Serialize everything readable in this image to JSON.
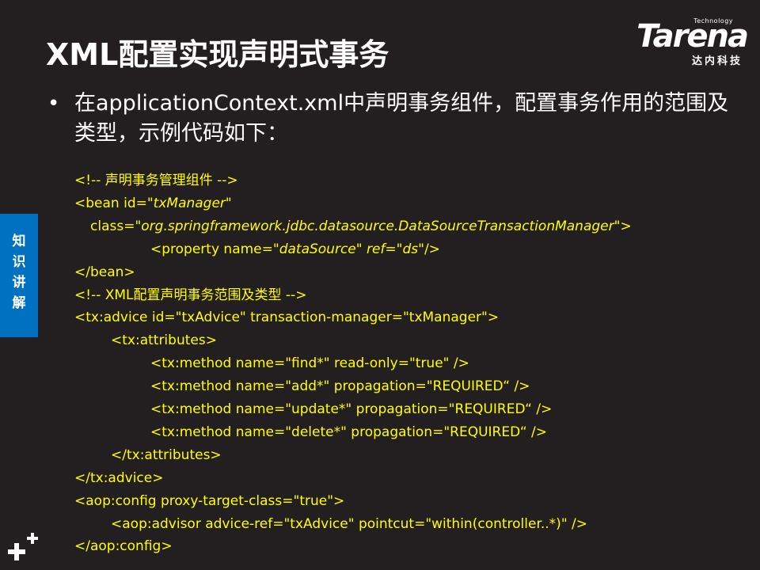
{
  "slide": {
    "title": "XML配置实现声明式事务",
    "bullet": "在applicationContext.xml中声明事务组件，配置事务作用的范围及类型，示例代码如下：",
    "side_tab": [
      "知",
      "识",
      "讲",
      "解"
    ],
    "logo": {
      "small": "Technology",
      "word": "Tarena",
      "cn": "达内科技"
    },
    "code_lines": [
      {
        "indent": 0,
        "parts": [
          {
            "t": "<!-- 声明事务管理组件 -->"
          }
        ]
      },
      {
        "indent": 0,
        "parts": [
          {
            "t": "<bean id=\""
          },
          {
            "t": "txManager\"",
            "i": true
          }
        ]
      },
      {
        "indent": 20,
        "parts": [
          {
            "t": "class=\""
          },
          {
            "t": "org.springframework.jdbc.datasource.DataSourceTransactionManager\"",
            "i": true
          },
          {
            "t": ">"
          }
        ]
      },
      {
        "indent": 96,
        "parts": [
          {
            "t": "<property name=\""
          },
          {
            "t": "dataSource\" ref=\"ds\"",
            "i": true
          },
          {
            "t": "/>"
          }
        ]
      },
      {
        "indent": 0,
        "parts": [
          {
            "t": "</bean>"
          }
        ]
      },
      {
        "indent": 0,
        "parts": [
          {
            "t": "<!-- XML配置声明事务范围及类型 -->"
          }
        ]
      },
      {
        "indent": 0,
        "parts": [
          {
            "t": "<tx:advice id=\"txAdvice\" transaction-manager=\"txManager\">"
          }
        ]
      },
      {
        "indent": 46,
        "parts": [
          {
            "t": "<tx:attributes>"
          }
        ]
      },
      {
        "indent": 96,
        "parts": [
          {
            "t": "<tx:method name=\"find*\" read-only=\"true\" />"
          }
        ]
      },
      {
        "indent": 96,
        "parts": [
          {
            "t": "<tx:method name=\"add*\" propagation=\"REQUIRED“ />"
          }
        ]
      },
      {
        "indent": 96,
        "parts": [
          {
            "t": "<tx:method name=\"update*\" propagation=\"REQUIRED“ />"
          }
        ]
      },
      {
        "indent": 96,
        "parts": [
          {
            "t": "<tx:method name=\"delete*\" propagation=\"REQUIRED“ />"
          }
        ]
      },
      {
        "indent": 46,
        "parts": [
          {
            "t": "</tx:attributes>"
          }
        ]
      },
      {
        "indent": 0,
        "parts": [
          {
            "t": "</tx:advice>"
          }
        ]
      },
      {
        "indent": 0,
        "parts": [
          {
            "t": "<aop:config proxy-target-class=\"true\">"
          }
        ]
      },
      {
        "indent": 46,
        "parts": [
          {
            "t": "<aop:advisor advice-ref=\"txAdvice\"  pointcut=\"within(controller..*)\" />"
          }
        ]
      },
      {
        "indent": 0,
        "parts": [
          {
            "t": "</aop:config>"
          }
        ]
      }
    ],
    "colors": {
      "background": "#231f20",
      "code": "#ffff00",
      "side_tab": "#0070c0",
      "text": "#ffffff"
    }
  }
}
